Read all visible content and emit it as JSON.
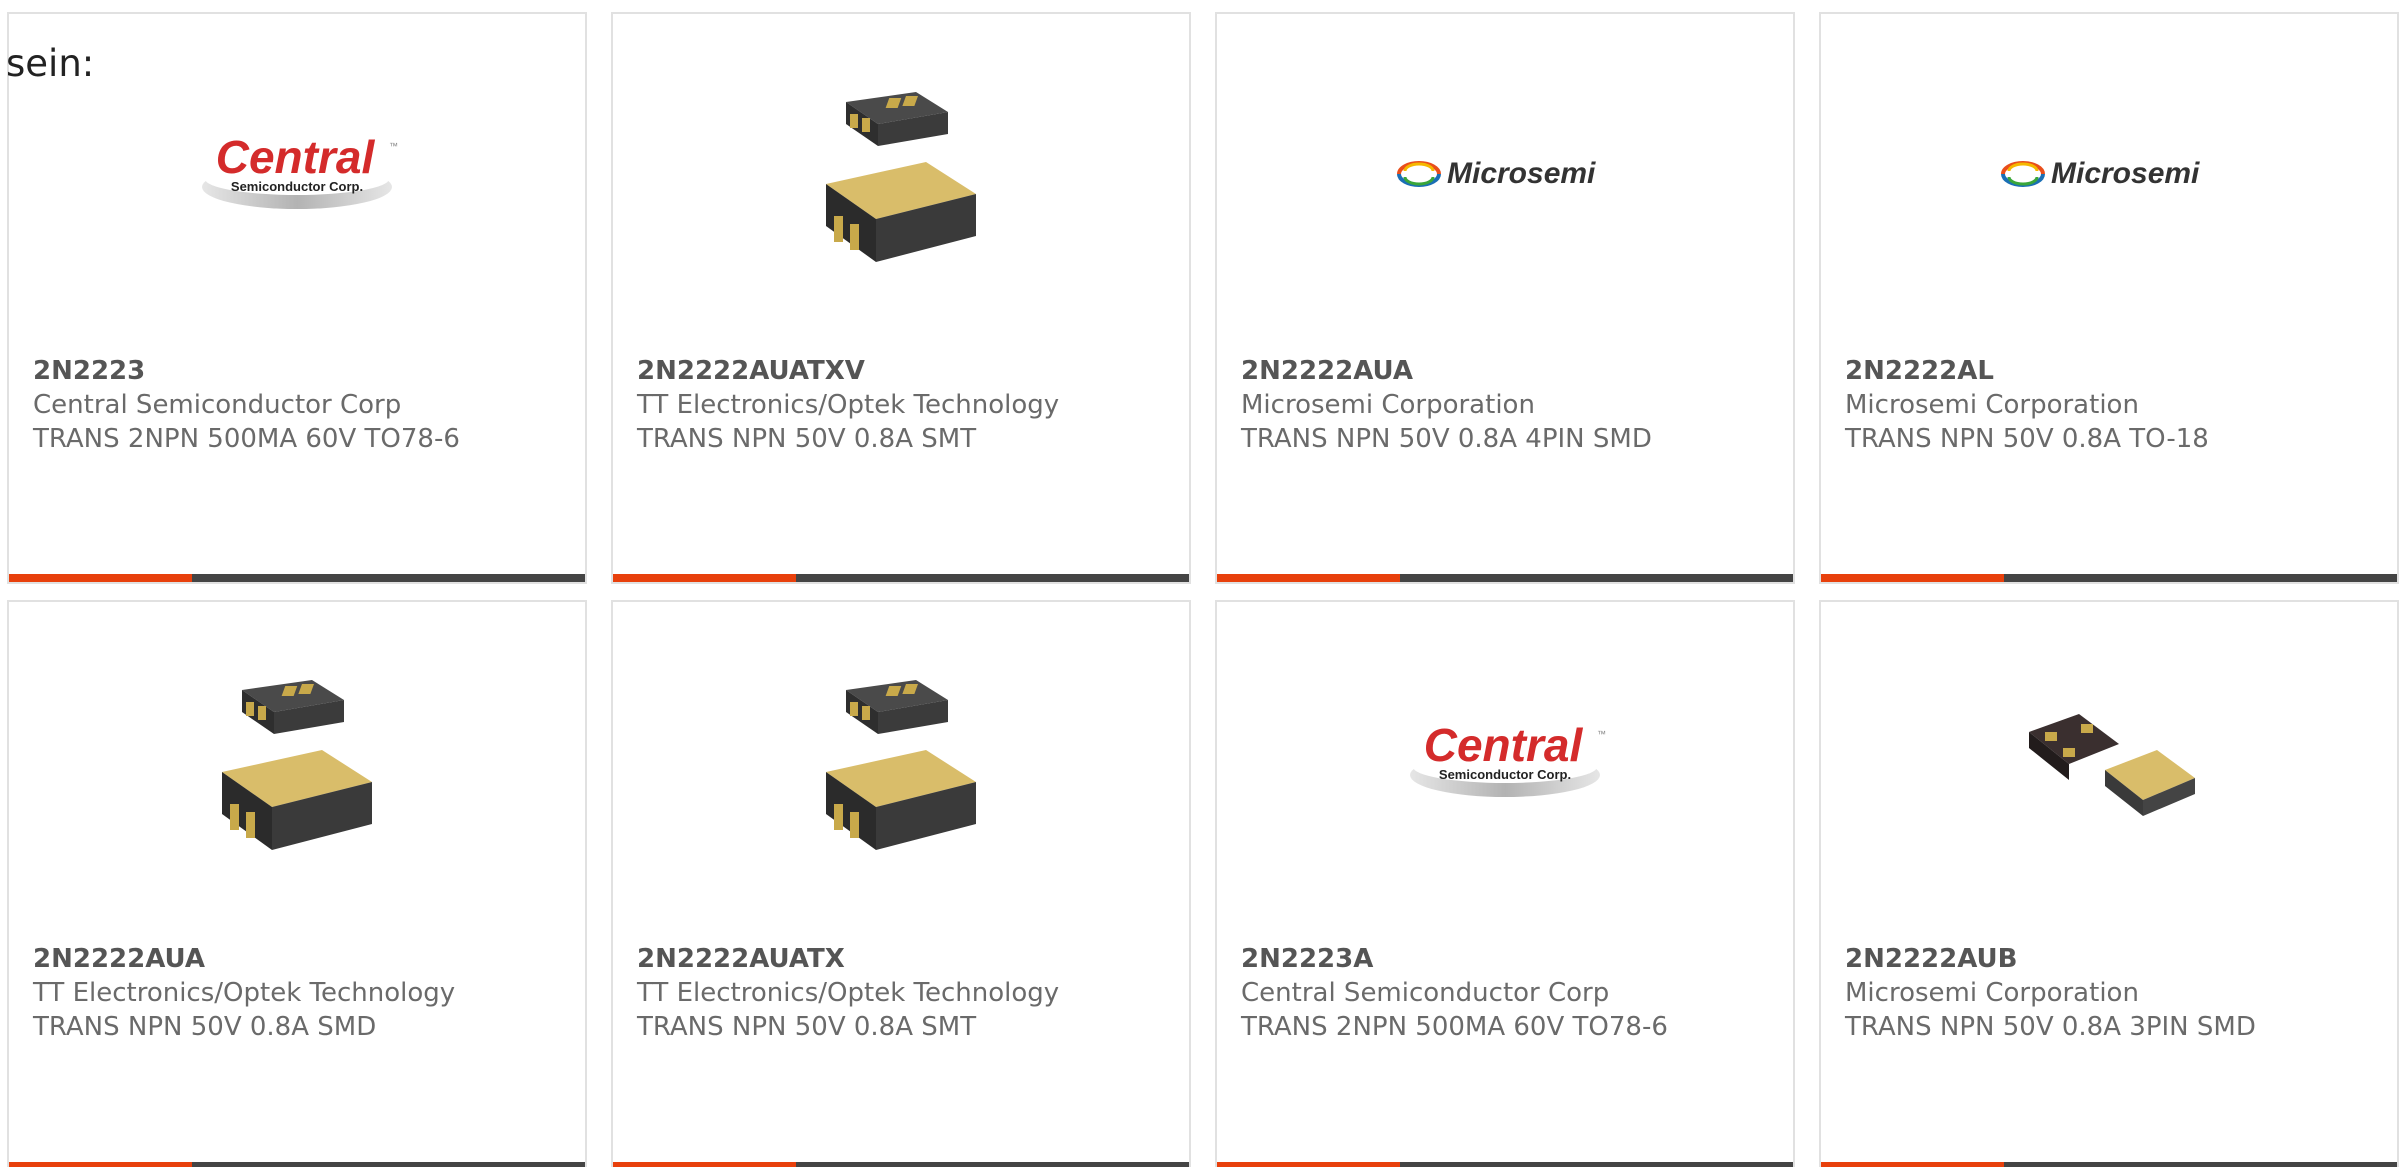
{
  "intro": "sein:",
  "colors": {
    "accent_bar": "#e8400c",
    "dark_bar": "#444444",
    "card_border": "#e1e1e1"
  },
  "logos": {
    "central": {
      "main": "Central",
      "sub": "Semiconductor Corp.",
      "tm": "™"
    },
    "microsemi": {
      "name": "Microsemi"
    }
  },
  "products": [
    {
      "part": "2N2223",
      "manufacturer": "Central Semiconductor Corp",
      "description": "TRANS 2NPN 500MA 60V TO78-6",
      "image": "central-logo"
    },
    {
      "part": "2N2222AUATXV",
      "manufacturer": "TT Electronics/Optek Technology",
      "description": "TRANS NPN 50V 0.8A SMT",
      "image": "smd-package-photo"
    },
    {
      "part": "2N2222AUA",
      "manufacturer": "Microsemi Corporation",
      "description": "TRANS NPN 50V 0.8A 4PIN SMD",
      "image": "microsemi-logo"
    },
    {
      "part": "2N2222AL",
      "manufacturer": "Microsemi Corporation",
      "description": "TRANS NPN 50V 0.8A TO-18",
      "image": "microsemi-logo"
    },
    {
      "part": "2N2222AUA",
      "manufacturer": "TT Electronics/Optek Technology",
      "description": "TRANS NPN 50V 0.8A SMD",
      "image": "smd-package-photo"
    },
    {
      "part": "2N2222AUATX",
      "manufacturer": "TT Electronics/Optek Technology",
      "description": "TRANS NPN 50V 0.8A SMT",
      "image": "smd-package-photo"
    },
    {
      "part": "2N2223A",
      "manufacturer": "Central Semiconductor Corp",
      "description": "TRANS 2NPN 500MA 60V TO78-6",
      "image": "central-logo"
    },
    {
      "part": "2N2222AUB",
      "manufacturer": "Microsemi Corporation",
      "description": "TRANS NPN 50V 0.8A 3PIN SMD",
      "image": "small-smd-package-photo"
    }
  ]
}
